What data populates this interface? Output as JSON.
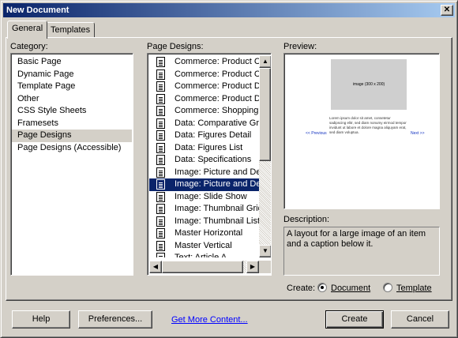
{
  "window": {
    "title": "New Document",
    "close_glyph": "✕"
  },
  "tabs": [
    {
      "label": "General",
      "active": true
    },
    {
      "label": "Templates",
      "active": false
    }
  ],
  "category": {
    "label": "Category:",
    "items": [
      "Basic Page",
      "Dynamic Page",
      "Template Page",
      "Other",
      "CSS Style Sheets",
      "Framesets",
      "Page Designs",
      "Page Designs (Accessible)"
    ],
    "selected": "Page Designs"
  },
  "designs": {
    "label": "Page Designs:",
    "items": [
      "Commerce: Product Catalog A",
      "Commerce: Product Catalog B",
      "Commerce: Product Detail A",
      "Commerce: Product Detail B",
      "Commerce: Shopping Cart",
      "Data: Comparative Grid",
      "Data: Figures Detail",
      "Data: Figures List",
      "Data: Specifications",
      "Image: Picture and Description",
      "Image: Picture and Description",
      "Image: Slide Show",
      "Image: Thumbnail Grid",
      "Image: Thumbnail List",
      "Master Horizontal",
      "Master Vertical",
      "Text: Article A"
    ],
    "selected_index": 10,
    "scroll_up_glyph": "▲",
    "scroll_down_glyph": "▼",
    "scroll_left_glyph": "◀",
    "scroll_right_glyph": "▶"
  },
  "preview": {
    "label": "Preview:",
    "image_text": "image (300 x 200)",
    "body_text": "Lorem ipsum dolor sit amet, consetetur sadipscing elitr, sed diam nonumy eirmod tempor invidunt ut labore et dolore magna aliquyam erat, sed diam voluptua.",
    "prev_link": "<< Previous",
    "next_link": "Next >>"
  },
  "description": {
    "label": "Description:",
    "text": "A layout for a large image of an item and a caption below it."
  },
  "create": {
    "label": "Create:",
    "document_label": "Document",
    "template_label": "Template",
    "selected": "Document"
  },
  "buttons": {
    "help": "Help",
    "preferences": "Preferences...",
    "get_more": "Get More Content...",
    "create": "Create",
    "cancel": "Cancel"
  },
  "colors": {
    "titlebar_start": "#0a246a",
    "titlebar_end": "#a6caf0",
    "selection": "#0a246a",
    "link": "#0000ff",
    "dialog_bg": "#d4d0c8"
  }
}
